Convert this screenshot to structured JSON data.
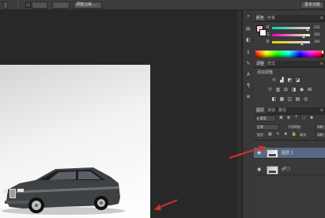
{
  "options_bar": {
    "buttons": [
      "",
      "",
      "",
      "",
      "",
      "调整边缘..."
    ],
    "workspace_label": "基本功能"
  },
  "color_panel": {
    "tabs": [
      "颜色",
      "色板"
    ],
    "sliders": [
      {
        "label": "R",
        "value": "232"
      },
      {
        "label": "G",
        "value": "205"
      },
      {
        "label": "B",
        "value": "191"
      }
    ]
  },
  "adjustments_panel": {
    "tabs": [
      "调整",
      "样式"
    ],
    "title": "添加调整",
    "icons": [
      "brightness-icon",
      "levels-icon",
      "curves-icon",
      "exposure-icon",
      "vibrance-icon",
      "hue-icon",
      "balance-icon",
      "bw-icon",
      "photo-filter-icon",
      "channel-mixer-icon",
      "lookup-icon",
      "invert-icon",
      "posterize-icon",
      "threshold-icon",
      "gradient-map-icon",
      "selective-color-icon"
    ]
  },
  "layers_panel": {
    "tabs": [
      "图层",
      "通道",
      "路径"
    ],
    "filter_label": "ρ 类型",
    "blend_mode": "正常",
    "opacity_label": "不透明度:",
    "opacity_value": "100",
    "lock_label": "锁定:",
    "fill_label": "填充:",
    "fill_value": "100",
    "layers": [
      {
        "name": "图层 1",
        "selected": true
      },
      {
        "name": "",
        "selected": false
      }
    ]
  },
  "colors": {
    "annotation_arrow": "#d6302a",
    "foreground_swatch": "#e8cdbf"
  }
}
